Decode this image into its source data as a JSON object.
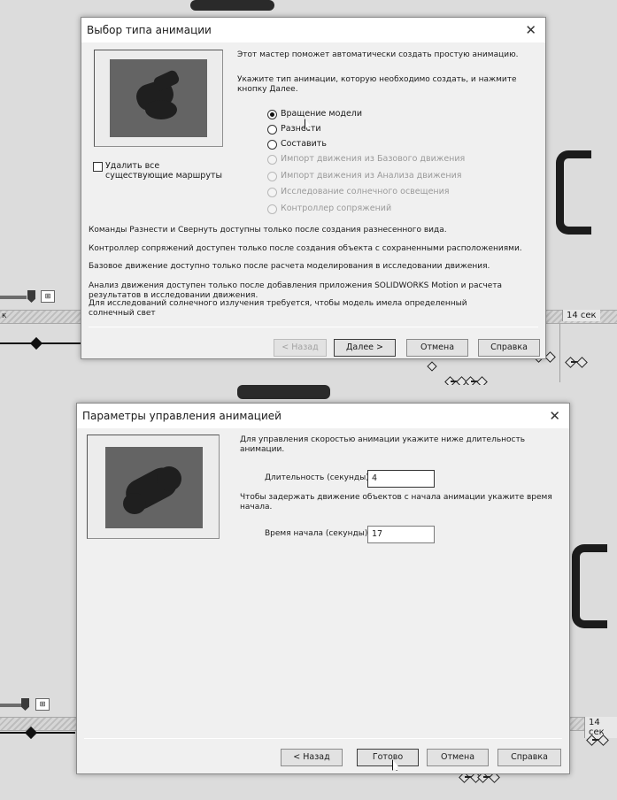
{
  "background_top": {
    "time_label": "14 сек",
    "ruler_letter": "к"
  },
  "background_bottom": {
    "time_label": "14 сек"
  },
  "dialog1": {
    "title": "Выбор типа анимации",
    "close_glyph": "✕",
    "intro": "Этот мастер поможет автоматически создать простую анимацию.",
    "instruction": "Укажите тип анимации, которую необходимо создать, и нажмите кнопку Далее.",
    "radios": [
      {
        "label": "Вращение модели",
        "selected": true,
        "enabled": true
      },
      {
        "label": "Разнести",
        "selected": false,
        "enabled": true
      },
      {
        "label": "Составить",
        "selected": false,
        "enabled": true
      },
      {
        "label": "Импорт движения из Базового движения",
        "selected": false,
        "enabled": false
      },
      {
        "label": "Импорт движения из Анализа движения",
        "selected": false,
        "enabled": false
      },
      {
        "label": "Исследование солнечного освещения",
        "selected": false,
        "enabled": false
      },
      {
        "label": "Контроллер сопряжений",
        "selected": false,
        "enabled": false
      }
    ],
    "delete_routes_label": "Удалить все существующие маршруты",
    "notes": [
      "Команды Разнести и Свернуть доступны только после создания разнесенного вида.",
      "Контроллер сопряжений доступен только после создания объекта с сохраненными расположениями.",
      "Базовое движение доступно только после расчета моделирования в исследовании движения.",
      "Анализ движения доступен только после добавления приложения SOLIDWORKS Motion и расчета результатов в исследовании движения.",
      "Для исследований солнечного излучения требуется, чтобы модель имела определенный солнечный свет"
    ],
    "buttons": {
      "back": "< Назад",
      "next": "Далее >",
      "cancel": "Отмена",
      "help": "Справка"
    }
  },
  "dialog2": {
    "title": "Параметры управления анимацией",
    "close_glyph": "✕",
    "duration_hint": "Для управления скоростью анимации укажите ниже длительность анимации.",
    "duration_label": "Длительность (секунды):",
    "duration_value": "4",
    "delay_hint": "Чтобы задержать движение объектов с начала анимации укажите время начала.",
    "start_label": "Время начала (секунды):",
    "start_value": "17",
    "buttons": {
      "back": "< Назад",
      "finish": "Готово",
      "cancel": "Отмена",
      "help": "Справка"
    }
  },
  "colors": {
    "dialog_bg": "#f0f0f0",
    "title_bg": "#ffffff",
    "workspace_bg": "#dcdcdc"
  }
}
